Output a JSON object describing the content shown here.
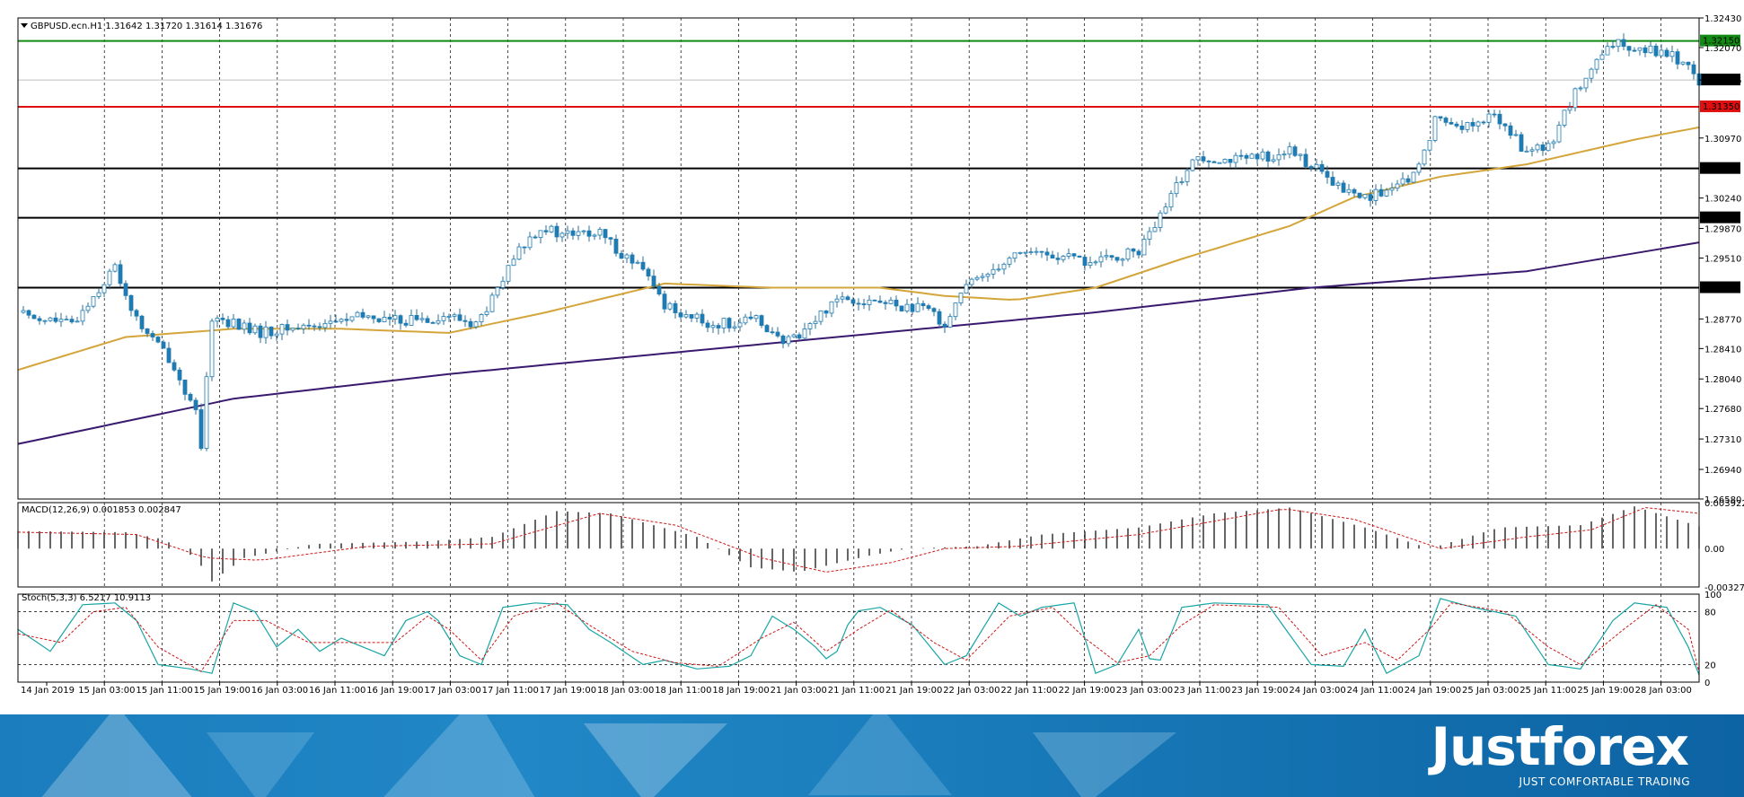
{
  "chart_data": {
    "type": "candlestick",
    "symbol": "GBPUSD.ecn.H1",
    "header": "GBPUSD.ecn.H1  1.31642 1.31720 1.31614 1.31676",
    "price_ticks": [
      "1.32430",
      "1.32070",
      "1.31676",
      "1.30970",
      "1.30240",
      "1.29870",
      "1.29510",
      "1.28770",
      "1.28410",
      "1.28040",
      "1.27680",
      "1.27310",
      "1.26940",
      "1.26580"
    ],
    "ylim": [
      1.2658,
      1.3243
    ],
    "current_price": "1.31676",
    "levels": [
      {
        "value": 1.3215,
        "label": "1.32150",
        "color": "#138a13"
      },
      {
        "value": 1.3135,
        "label": "1.31350",
        "color": "#e01010"
      },
      {
        "value": 1.306,
        "label": "1.30600",
        "color": "#000000"
      },
      {
        "value": 1.3,
        "label": "1.30000",
        "color": "#000000"
      },
      {
        "value": 1.2915,
        "label": "1.29150",
        "color": "#000000"
      }
    ],
    "time_labels": [
      "14 Jan 2019",
      "15 Jan 03:00",
      "15 Jan 11:00",
      "15 Jan 19:00",
      "16 Jan 03:00",
      "16 Jan 11:00",
      "16 Jan 19:00",
      "17 Jan 03:00",
      "17 Jan 11:00",
      "17 Jan 19:00",
      "18 Jan 03:00",
      "18 Jan 11:00",
      "18 Jan 19:00",
      "21 Jan 03:00",
      "21 Jan 11:00",
      "21 Jan 19:00",
      "22 Jan 03:00",
      "22 Jan 11:00",
      "22 Jan 19:00",
      "23 Jan 03:00",
      "23 Jan 11:00",
      "23 Jan 19:00",
      "24 Jan 03:00",
      "24 Jan 11:00",
      "24 Jan 19:00",
      "25 Jan 03:00",
      "25 Jan 11:00",
      "25 Jan 19:00",
      "28 Jan 03:00"
    ],
    "close_path": [
      [
        0,
        1.2885
      ],
      [
        10,
        1.287
      ],
      [
        18,
        1.294
      ],
      [
        22,
        1.2875
      ],
      [
        28,
        1.283
      ],
      [
        31,
        1.279
      ],
      [
        33,
        1.276
      ],
      [
        34,
        1.272
      ],
      [
        36,
        1.288
      ],
      [
        45,
        1.286
      ],
      [
        55,
        1.287
      ],
      [
        65,
        1.288
      ],
      [
        70,
        1.2875
      ],
      [
        80,
        1.288
      ],
      [
        85,
        1.287
      ],
      [
        88,
        1.29
      ],
      [
        93,
        1.296
      ],
      [
        97,
        1.299
      ],
      [
        100,
        1.298
      ],
      [
        108,
        1.298
      ],
      [
        116,
        1.2935
      ],
      [
        120,
        1.2895
      ],
      [
        128,
        1.287
      ],
      [
        138,
        1.2875
      ],
      [
        142,
        1.2845
      ],
      [
        148,
        1.2875
      ],
      [
        152,
        1.2905
      ],
      [
        162,
        1.2895
      ],
      [
        170,
        1.2885
      ],
      [
        172,
        1.287
      ],
      [
        175,
        1.291
      ],
      [
        180,
        1.2935
      ],
      [
        186,
        1.296
      ],
      [
        200,
        1.2945
      ],
      [
        208,
        1.296
      ],
      [
        212,
        1.3
      ],
      [
        216,
        1.305
      ],
      [
        219,
        1.3075
      ],
      [
        228,
        1.307
      ],
      [
        236,
        1.308
      ],
      [
        240,
        1.3065
      ],
      [
        244,
        1.304
      ],
      [
        249,
        1.3025
      ],
      [
        256,
        1.3035
      ],
      [
        260,
        1.306
      ],
      [
        263,
        1.312
      ],
      [
        270,
        1.311
      ],
      [
        274,
        1.3125
      ],
      [
        280,
        1.308
      ],
      [
        284,
        1.3085
      ],
      [
        288,
        1.314
      ],
      [
        292,
        1.318
      ],
      [
        296,
        1.321
      ],
      [
        300,
        1.321
      ],
      [
        306,
        1.32
      ],
      [
        310,
        1.3185
      ],
      [
        312,
        1.31676
      ]
    ],
    "ma_fast": [
      [
        0,
        1.2815
      ],
      [
        20,
        1.2855
      ],
      [
        40,
        1.2865
      ],
      [
        60,
        1.2865
      ],
      [
        80,
        1.286
      ],
      [
        98,
        1.2885
      ],
      [
        120,
        1.292
      ],
      [
        140,
        1.2915
      ],
      [
        160,
        1.2915
      ],
      [
        172,
        1.2905
      ],
      [
        185,
        1.29
      ],
      [
        200,
        1.2915
      ],
      [
        216,
        1.295
      ],
      [
        236,
        1.299
      ],
      [
        248,
        1.3025
      ],
      [
        264,
        1.305
      ],
      [
        280,
        1.3065
      ],
      [
        300,
        1.3095
      ],
      [
        312,
        1.311
      ]
    ],
    "ma_slow": [
      [
        0,
        1.2725
      ],
      [
        40,
        1.278
      ],
      [
        80,
        1.281
      ],
      [
        120,
        1.2835
      ],
      [
        160,
        1.286
      ],
      [
        200,
        1.2885
      ],
      [
        240,
        1.2915
      ],
      [
        280,
        1.2935
      ],
      [
        312,
        1.297
      ]
    ],
    "macd": {
      "header": "MACD(12,26,9) 0.001853 0.002847",
      "ticks": [
        "0.003922",
        "0.00",
        "-0.003274"
      ],
      "ylim": [
        -0.003274,
        0.003922
      ],
      "hist": [
        [
          0,
          0.0015
        ],
        [
          20,
          0.0014
        ],
        [
          27,
          0.0008
        ],
        [
          33,
          -0.0008
        ],
        [
          36,
          -0.0028
        ],
        [
          42,
          -0.0008
        ],
        [
          55,
          0.0004
        ],
        [
          75,
          0.0006
        ],
        [
          88,
          0.001
        ],
        [
          100,
          0.0032
        ],
        [
          110,
          0.003
        ],
        [
          126,
          0.001
        ],
        [
          136,
          -0.0016
        ],
        [
          145,
          -0.002
        ],
        [
          158,
          -0.0006
        ],
        [
          165,
          0.0
        ],
        [
          178,
          0.0002
        ],
        [
          190,
          0.0012
        ],
        [
          208,
          0.0018
        ],
        [
          222,
          0.003
        ],
        [
          236,
          0.0035
        ],
        [
          250,
          0.0018
        ],
        [
          262,
          0.0
        ],
        [
          275,
          0.0018
        ],
        [
          290,
          0.002
        ],
        [
          300,
          0.0036
        ],
        [
          312,
          0.0019
        ]
      ],
      "signal": [
        [
          0,
          0.0014
        ],
        [
          22,
          0.0012
        ],
        [
          35,
          -0.0008
        ],
        [
          45,
          -0.001
        ],
        [
          65,
          0.0002
        ],
        [
          88,
          0.0004
        ],
        [
          108,
          0.003
        ],
        [
          122,
          0.002
        ],
        [
          138,
          -0.0008
        ],
        [
          150,
          -0.002
        ],
        [
          162,
          -0.0012
        ],
        [
          172,
          0.0
        ],
        [
          186,
          0.0002
        ],
        [
          208,
          0.0012
        ],
        [
          235,
          0.0034
        ],
        [
          248,
          0.0025
        ],
        [
          264,
          0.0
        ],
        [
          280,
          0.001
        ],
        [
          292,
          0.0016
        ],
        [
          302,
          0.0035
        ],
        [
          312,
          0.003
        ]
      ]
    },
    "stoch": {
      "header": "Stoch(5,3,3) 6.5217 10.9113",
      "ticks": [
        "100",
        "80",
        "20",
        "0"
      ],
      "ylim": [
        0,
        100
      ],
      "main": [
        [
          0,
          60
        ],
        [
          6,
          35
        ],
        [
          12,
          88
        ],
        [
          18,
          90
        ],
        [
          22,
          70
        ],
        [
          26,
          20
        ],
        [
          32,
          15
        ],
        [
          36,
          10
        ],
        [
          40,
          90
        ],
        [
          44,
          80
        ],
        [
          48,
          40
        ],
        [
          52,
          60
        ],
        [
          56,
          35
        ],
        [
          60,
          50
        ],
        [
          64,
          40
        ],
        [
          68,
          30
        ],
        [
          72,
          70
        ],
        [
          76,
          80
        ],
        [
          78,
          70
        ],
        [
          82,
          30
        ],
        [
          86,
          20
        ],
        [
          90,
          85
        ],
        [
          96,
          90
        ],
        [
          102,
          88
        ],
        [
          106,
          60
        ],
        [
          110,
          45
        ],
        [
          116,
          20
        ],
        [
          120,
          25
        ],
        [
          126,
          15
        ],
        [
          132,
          18
        ],
        [
          136,
          30
        ],
        [
          140,
          75
        ],
        [
          144,
          60
        ],
        [
          148,
          40
        ],
        [
          151,
          20
        ],
        [
          155,
          80
        ],
        [
          160,
          85
        ],
        [
          166,
          65
        ],
        [
          172,
          20
        ],
        [
          176,
          30
        ],
        [
          182,
          90
        ],
        [
          186,
          75
        ],
        [
          190,
          85
        ],
        [
          196,
          90
        ],
        [
          200,
          10
        ],
        [
          204,
          20
        ],
        [
          208,
          60
        ],
        [
          211,
          10
        ],
        [
          216,
          85
        ],
        [
          222,
          90
        ],
        [
          232,
          88
        ],
        [
          240,
          20
        ],
        [
          246,
          18
        ],
        [
          250,
          60
        ],
        [
          254,
          10
        ],
        [
          260,
          30
        ],
        [
          264,
          95
        ],
        [
          270,
          85
        ],
        [
          278,
          75
        ],
        [
          284,
          20
        ],
        [
          290,
          15
        ],
        [
          296,
          70
        ],
        [
          300,
          90
        ],
        [
          306,
          85
        ],
        [
          310,
          40
        ],
        [
          312,
          8
        ]
      ],
      "signal": [
        [
          0,
          55
        ],
        [
          8,
          45
        ],
        [
          14,
          80
        ],
        [
          20,
          85
        ],
        [
          26,
          40
        ],
        [
          34,
          12
        ],
        [
          40,
          70
        ],
        [
          46,
          70
        ],
        [
          54,
          45
        ],
        [
          62,
          45
        ],
        [
          70,
          45
        ],
        [
          76,
          75
        ],
        [
          80,
          60
        ],
        [
          86,
          25
        ],
        [
          92,
          75
        ],
        [
          100,
          90
        ],
        [
          106,
          65
        ],
        [
          114,
          35
        ],
        [
          122,
          22
        ],
        [
          130,
          18
        ],
        [
          138,
          50
        ],
        [
          144,
          68
        ],
        [
          150,
          35
        ],
        [
          156,
          60
        ],
        [
          162,
          82
        ],
        [
          170,
          45
        ],
        [
          176,
          25
        ],
        [
          184,
          75
        ],
        [
          192,
          85
        ],
        [
          198,
          50
        ],
        [
          204,
          22
        ],
        [
          210,
          30
        ],
        [
          216,
          65
        ],
        [
          222,
          88
        ],
        [
          234,
          85
        ],
        [
          242,
          30
        ],
        [
          250,
          45
        ],
        [
          256,
          25
        ],
        [
          262,
          60
        ],
        [
          266,
          90
        ],
        [
          276,
          80
        ],
        [
          284,
          40
        ],
        [
          290,
          20
        ],
        [
          298,
          60
        ],
        [
          304,
          88
        ],
        [
          310,
          60
        ],
        [
          312,
          11
        ]
      ]
    }
  },
  "brand": {
    "name": "Justforex",
    "tagline": "JUST COMFORTABLE TRADING",
    "color": "#1b7dbd"
  }
}
